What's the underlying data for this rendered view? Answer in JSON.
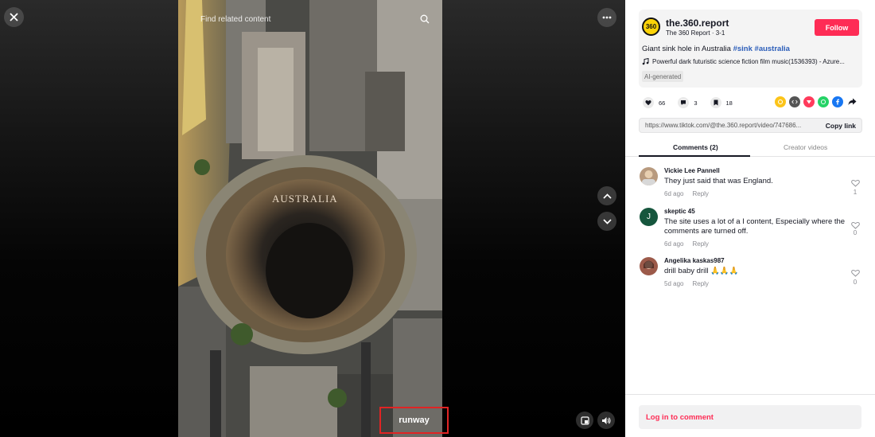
{
  "video": {
    "find_related": "Find related content",
    "overlay_text": "AUSTRALIA",
    "watermark": "runway"
  },
  "author": {
    "avatar_text": "360",
    "username": "the.360.report",
    "subtitle": "The 360 Report · 3-1",
    "follow_label": "Follow"
  },
  "post": {
    "caption_text": "Giant sink hole in Australia ",
    "hashtags": [
      "#sink",
      "#australia"
    ],
    "music": "Powerful dark futuristic science fiction film music(1536393) - Azure...",
    "ai_badge": "AI-generated"
  },
  "stats": {
    "likes": "66",
    "comments": "3",
    "saves": "18"
  },
  "share": {
    "icons": [
      "tiktok-coin-icon",
      "embed-icon",
      "pocket-icon",
      "whatsapp-icon",
      "facebook-icon",
      "share-arrow-icon"
    ],
    "colors": [
      "#fcc419",
      "#555555",
      "#ff3b5c",
      "#25d366",
      "#1877f2",
      "#161823"
    ]
  },
  "link": {
    "url": "https://www.tiktok.com/@the.360.report/video/747686...",
    "copy_label": "Copy link"
  },
  "tabs": {
    "comments": "Comments (2)",
    "creator": "Creator videos"
  },
  "comments": [
    {
      "author": "Vickie Lee Pannell",
      "text": "They just said that was England.",
      "date": "6d ago",
      "reply": "Reply",
      "likes": "1",
      "avatar_color": "#b89a7e"
    },
    {
      "author": "skeptic 45",
      "text": "The site uses a lot of a I content, Especially where the comments are turned off.",
      "date": "6d ago",
      "reply": "Reply",
      "likes": "0",
      "avatar_letter": "J",
      "avatar_color": "#16563d"
    },
    {
      "author": "Angelika kaskas987",
      "text": "drill baby drill 🙏🙏🙏",
      "date": "5d ago",
      "reply": "Reply",
      "likes": "0",
      "avatar_color": "#9c5a4a"
    }
  ],
  "footer": {
    "login": "Log in to comment"
  }
}
